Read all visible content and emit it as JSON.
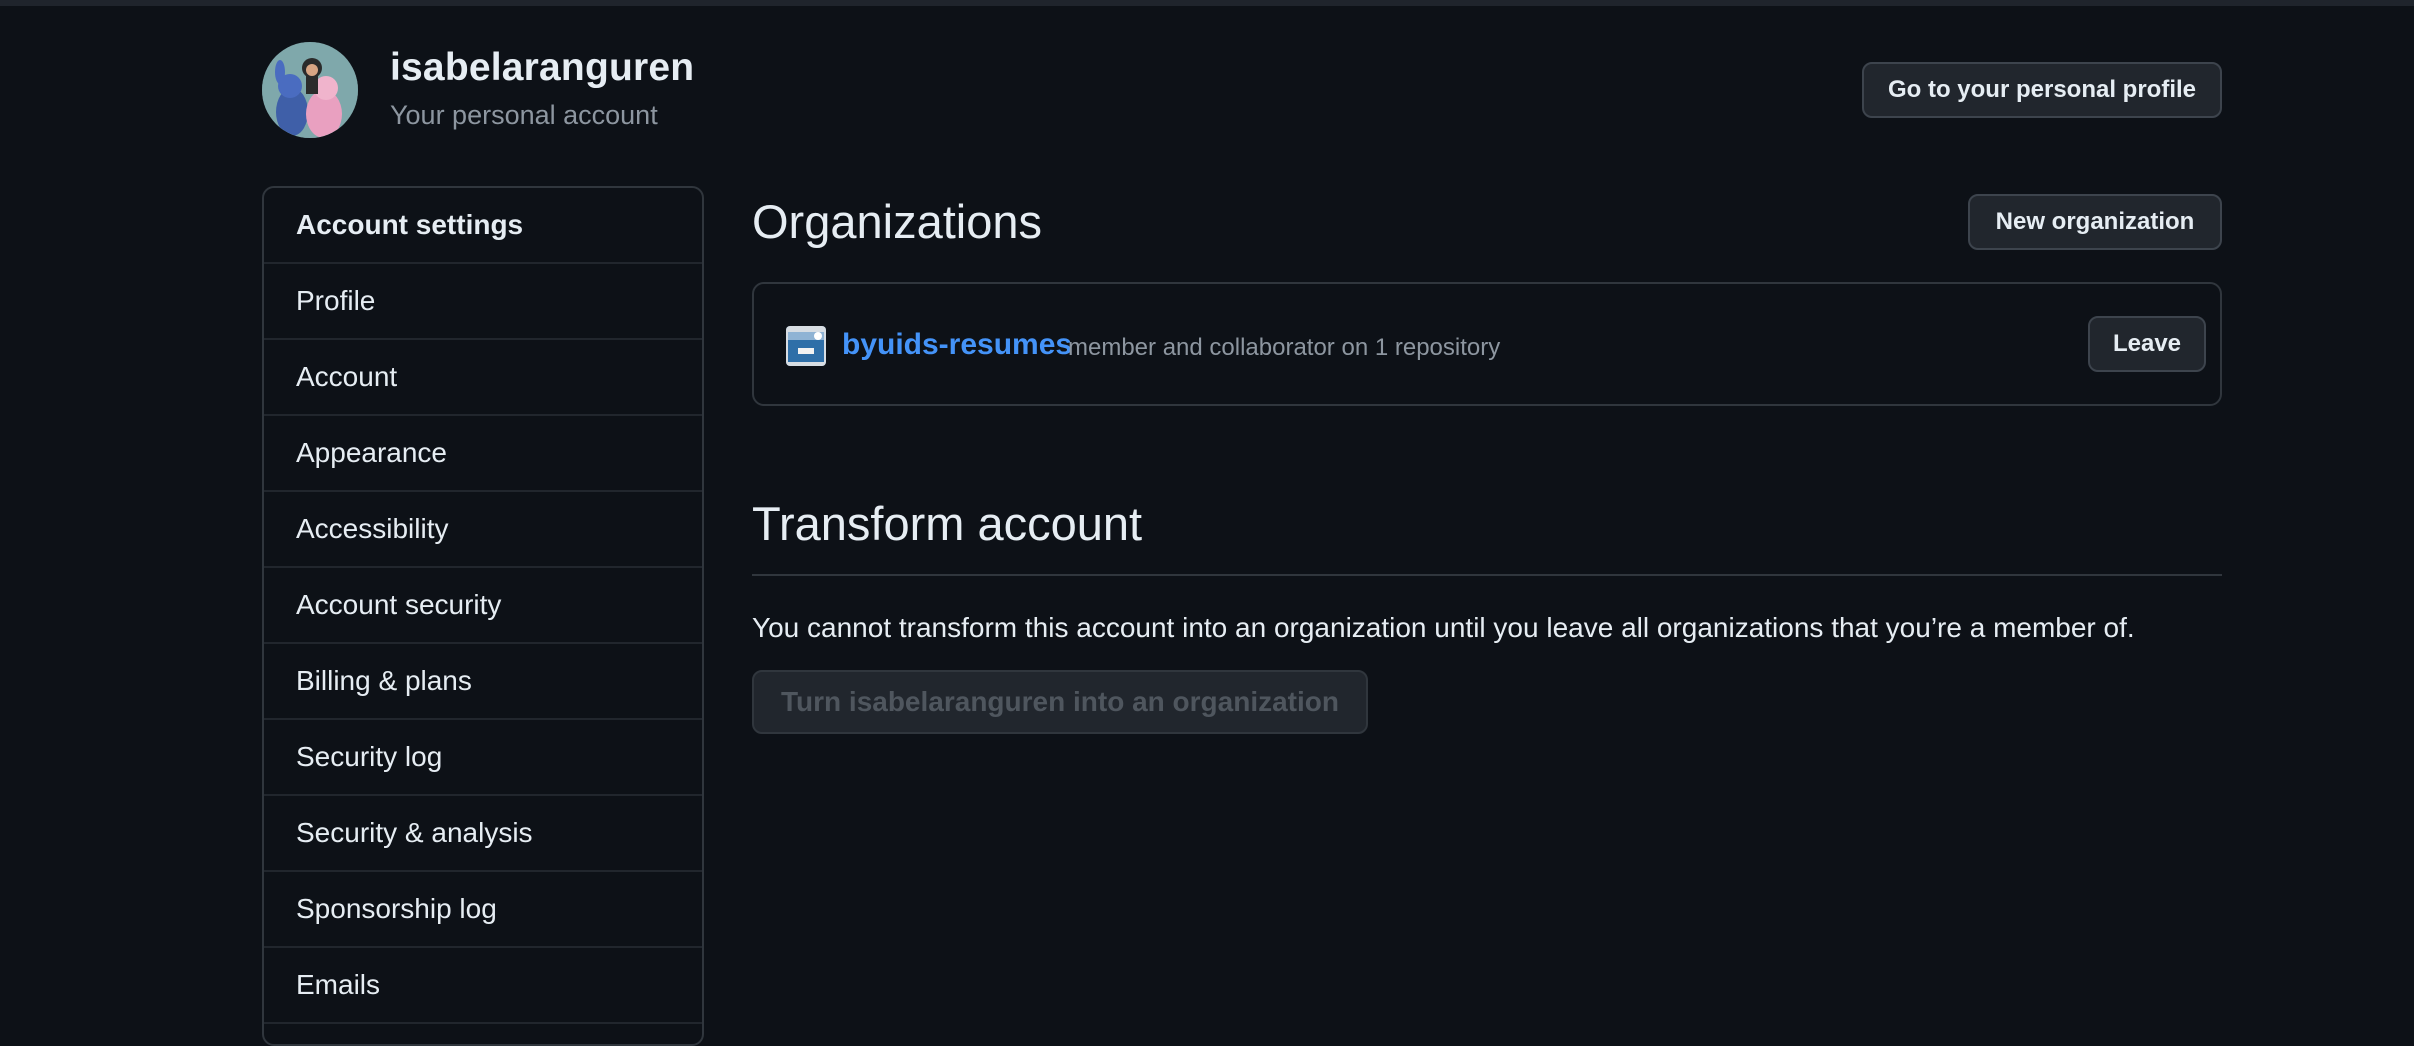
{
  "header": {
    "username": "isabelaranguren",
    "subtitle": "Your personal account",
    "profile_button": "Go to your personal profile"
  },
  "sidebar": {
    "heading": "Account settings",
    "items": [
      {
        "label": "Profile"
      },
      {
        "label": "Account"
      },
      {
        "label": "Appearance"
      },
      {
        "label": "Accessibility"
      },
      {
        "label": "Account security"
      },
      {
        "label": "Billing & plans"
      },
      {
        "label": "Security log"
      },
      {
        "label": "Security & analysis"
      },
      {
        "label": "Sponsorship log"
      },
      {
        "label": "Emails"
      }
    ]
  },
  "organizations": {
    "title": "Organizations",
    "new_button": "New organization",
    "list": [
      {
        "name": "byuids-resumes",
        "description": "member and collaborator on 1 repository",
        "leave_label": "Leave"
      }
    ]
  },
  "transform": {
    "title": "Transform account",
    "message": "You cannot transform this account into an organization until you leave all organizations that you’re a member of.",
    "button": "Turn isabelaranguren into an organization"
  },
  "colors": {
    "background": "#0d1117",
    "link": "#4493f8",
    "muted": "#8d96a0",
    "border": "#30363d"
  }
}
